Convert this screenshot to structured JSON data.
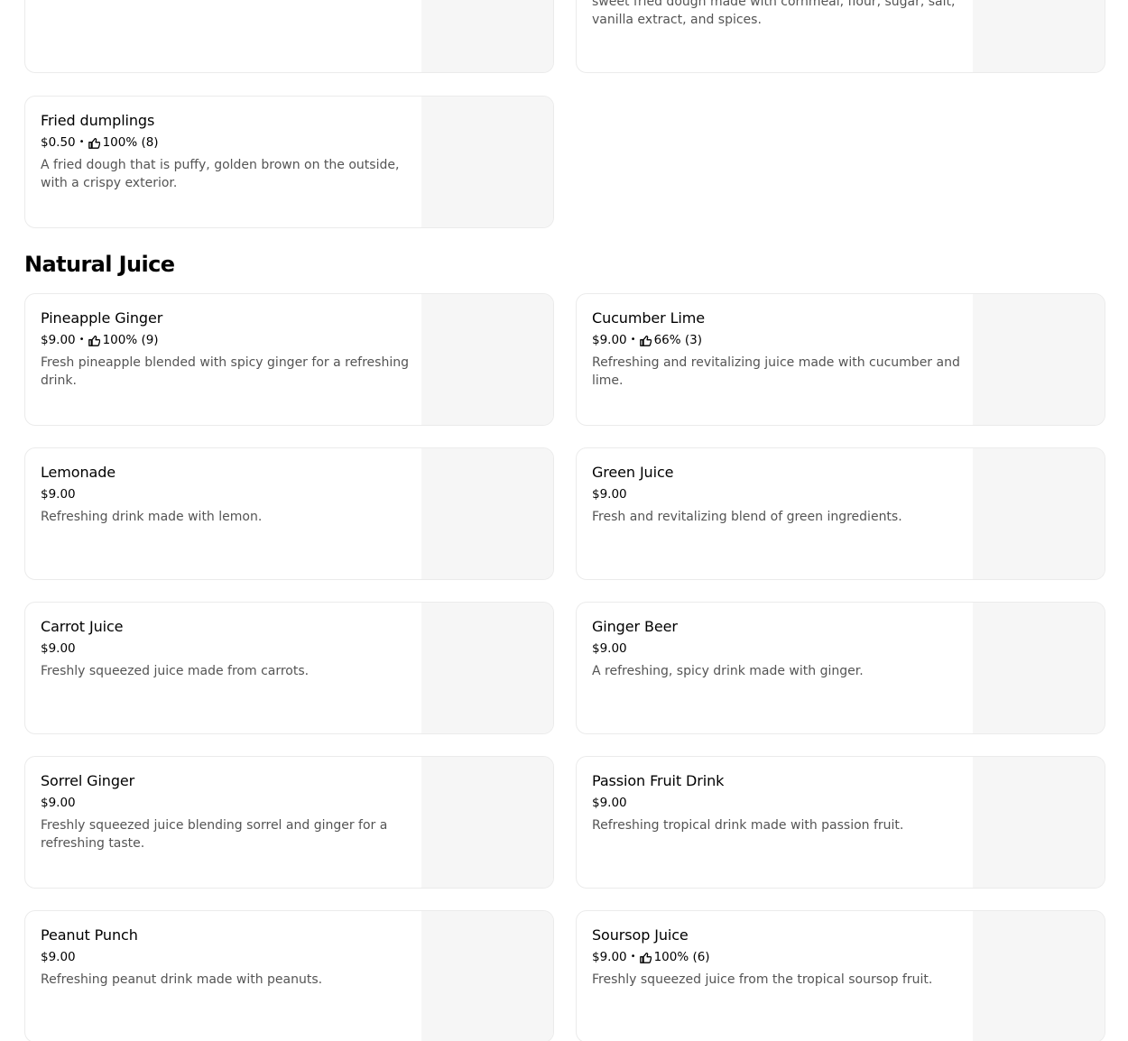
{
  "top_partial": {
    "right_desc": "sweet fried dough made with cornmeal, flour, sugar, salt, vanilla extract, and spices."
  },
  "fried_dumplings": {
    "name": "Fried dumplings",
    "price": "$0.50",
    "rating": "100% (8)",
    "desc": "A fried dough that is puffy, golden brown on the outside, with a crispy exterior."
  },
  "section": {
    "title": "Natural Juice"
  },
  "items": [
    {
      "name": "Pineapple Ginger",
      "price": "$9.00",
      "rating": "100% (9)",
      "desc": "Fresh pineapple blended with spicy ginger for a refreshing drink."
    },
    {
      "name": "Cucumber Lime",
      "price": "$9.00",
      "rating": "66% (3)",
      "desc": "Refreshing and revitalizing juice made with cucumber and lime."
    },
    {
      "name": "Lemonade",
      "price": "$9.00",
      "rating": "",
      "desc": "Refreshing drink made with lemon."
    },
    {
      "name": "Green Juice",
      "price": "$9.00",
      "rating": "",
      "desc": "Fresh and revitalizing blend of green ingredients."
    },
    {
      "name": "Carrot Juice",
      "price": "$9.00",
      "rating": "",
      "desc": "Freshly squeezed juice made from carrots."
    },
    {
      "name": "Ginger Beer",
      "price": "$9.00",
      "rating": "",
      "desc": "A refreshing, spicy drink made with ginger."
    },
    {
      "name": "Sorrel Ginger",
      "price": "$9.00",
      "rating": "",
      "desc": "Freshly squeezed juice blending sorrel and ginger for a refreshing taste."
    },
    {
      "name": "Passion Fruit Drink",
      "price": "$9.00",
      "rating": "",
      "desc": "Refreshing tropical drink made with passion fruit."
    },
    {
      "name": "Peanut Punch",
      "price": "$9.00",
      "rating": "",
      "desc": "Refreshing peanut drink made with peanuts."
    },
    {
      "name": "Soursop Juice",
      "price": "$9.00",
      "rating": "100% (6)",
      "desc": "Freshly squeezed juice from the tropical soursop fruit."
    }
  ],
  "icons": {
    "rating": "thumbs-up-icon"
  }
}
